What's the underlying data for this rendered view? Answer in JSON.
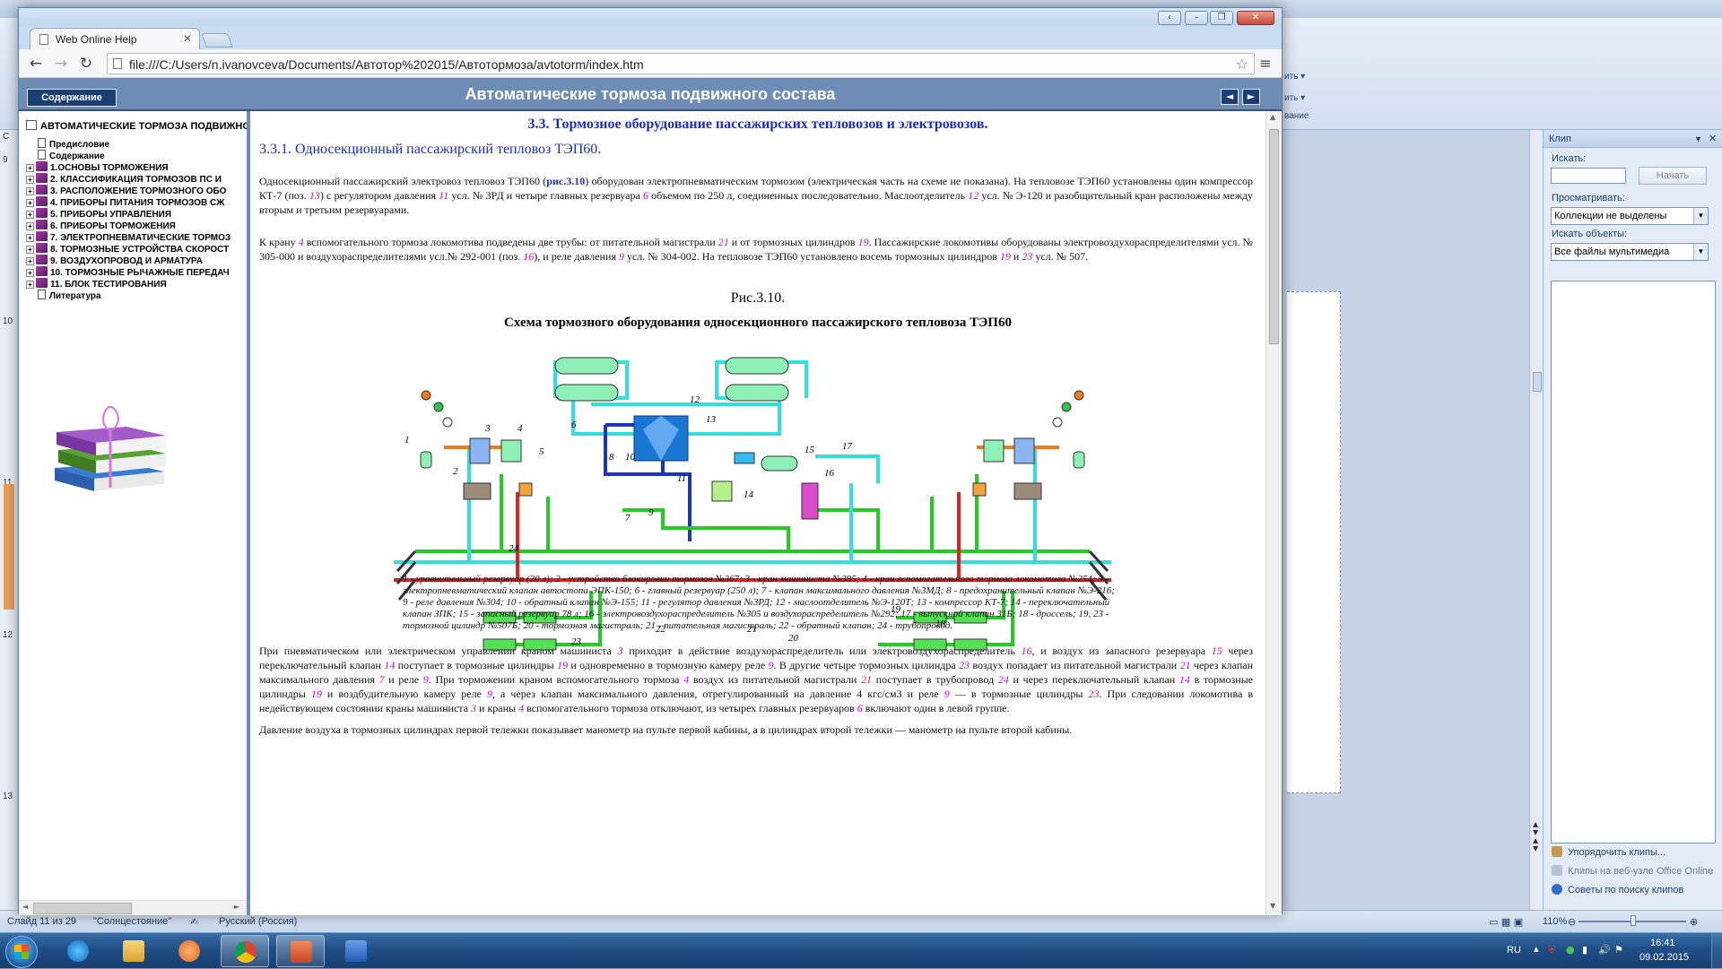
{
  "browser": {
    "tab_title": "Web Online Help",
    "url": "file:///C:/Users/n.ivanovceva/Documents/Автотор%202015/Автотормоза/avtotorm/index.htm",
    "caption_buttons": [
      "‹",
      "–",
      "❐",
      "✕"
    ]
  },
  "help": {
    "toc_tab_label": "Содержание",
    "title": "Автоматические тормоза подвижного состава",
    "nav_prev": "◄",
    "nav_next": "►"
  },
  "toc": {
    "root": "АВТОМАТИЧЕСКИЕ ТОРМОЗА ПОДВИЖНОГ",
    "items": [
      {
        "label": "Предисловие",
        "type": "page"
      },
      {
        "label": "Содержание",
        "type": "page"
      },
      {
        "label": "1.ОСНОВЫ ТОРМОЖЕНИЯ",
        "type": "book"
      },
      {
        "label": "2. КЛАССИФИКАЦИЯ ТОРМОЗОВ ПС И",
        "type": "book"
      },
      {
        "label": "3. РАСПОЛОЖЕНИЕ ТОРМОЗНОГО ОБО",
        "type": "book"
      },
      {
        "label": "4. ПРИБОРЫ ПИТАНИЯ ТОРМОЗОВ СЖ",
        "type": "book"
      },
      {
        "label": "5. ПРИБОРЫ УПРАВЛЕНИЯ",
        "type": "book"
      },
      {
        "label": "6. ПРИБОРЫ ТОРМОЖЕНИЯ",
        "type": "book"
      },
      {
        "label": "7. ЭЛЕКТРОПНЕВМАТИЧЕСКИЕ ТОРМОЗ",
        "type": "book"
      },
      {
        "label": "8. ТОРМОЗНЫЕ УСТРОЙСТВА СКОРОСТ",
        "type": "book"
      },
      {
        "label": "9. ВОЗДУХОПРОВОД И АРМАТУРА",
        "type": "book"
      },
      {
        "label": "10. ТОРМОЗНЫЕ РЫЧАЖНЫЕ ПЕРЕДАЧ",
        "type": "book"
      },
      {
        "label": "11. БЛОК ТЕСТИРОВАНИЯ",
        "type": "book"
      },
      {
        "label": "Литература",
        "type": "page"
      }
    ]
  },
  "content": {
    "section_heading": "3.3. Тормозное оборудование пассажирских тепловозов и электровозов.",
    "subsection_heading": "3.3.1. Односекционный пассажирский тепловоз ТЭП60.",
    "para1": [
      {
        "t": "Односекционный пассажирский электровоз тепловоз ТЭП60 ("
      },
      {
        "t": "рис.3.10",
        "c": "lnk"
      },
      {
        "t": ") оборудован электропневматическим тормозом (электрическая часть на схеме не показана). На тепловозе ТЭП60 установлены один компрессор КТ-7 (поз. "
      },
      {
        "t": "13",
        "c": "n"
      },
      {
        "t": ") с регулятором давления "
      },
      {
        "t": "11",
        "c": "n"
      },
      {
        "t": " усл. № ЗРД и четыре главных резервуара "
      },
      {
        "t": "6",
        "c": "n"
      },
      {
        "t": " объемом по 250 л, соединенных последовательно. Маслоотделитель "
      },
      {
        "t": "12",
        "c": "n"
      },
      {
        "t": " усл. № Э-120 и разобщительный кран расположены между вторым и третьим резервуарами."
      }
    ],
    "para2": [
      {
        "t": "К крану "
      },
      {
        "t": "4",
        "c": "n"
      },
      {
        "t": " вспомогательного тормоза локомотива подведены две трубы: от питательной магистрали "
      },
      {
        "t": "21",
        "c": "n"
      },
      {
        "t": " и от тормозных цилиндров "
      },
      {
        "t": "19",
        "c": "n"
      },
      {
        "t": ". Пассажирские локомотивы оборудованы электровоздухораспределителями усл. № 305-000 и воздухораспределителями усл.№ 292-001 (поз. "
      },
      {
        "t": "16",
        "c": "n"
      },
      {
        "t": "), и реле давления "
      },
      {
        "t": "9",
        "c": "n"
      },
      {
        "t": " усл. № 304-002. На тепловозе ТЭП60 установлено восемь тормозных цилиндров "
      },
      {
        "t": "19",
        "c": "n"
      },
      {
        "t": " и "
      },
      {
        "t": "23",
        "c": "n"
      },
      {
        "t": " усл. № 507."
      }
    ],
    "figure_number": "Рис.3.10.",
    "figure_title": "Схема тормозного оборудования односекционного пассажирского тепловоза ТЭП60",
    "diagram_labels": [
      "1",
      "2",
      "3",
      "4",
      "5",
      "6",
      "7",
      "8",
      "9",
      "10",
      "11",
      "12",
      "13",
      "14",
      "15",
      "16",
      "17",
      "18",
      "19",
      "20",
      "21",
      "22",
      "23",
      "24"
    ],
    "legend": "1 - уравнительный резервуар (20 л); 2 - устройство блокировки тормозов №367; 3 - кран машиниста №395; 4 - кран вспомогательного тормоза локомотива №254; 5 - электропневматический клапан автостопа ЭПК-150; 6 - главный резервуар (250 л); 7 - клапан максимального давления №3МД; 8 - предохранительный клапан №Э-216; 9 - реле давления №304; 10 - обратный клапан №Э-155; 11 - регулятор давления №3РД; 12 - маслоотделитель №Э-120Т; 13 - компрессор КТ-7; 14 - переключательный клапан ЗПК; 15 - запасный резервуар 78 л; 16 - электровоздухораспределитель №305 и воздухораспределитель №292; 17 - выпускной клапан 31Б; 18 - дроссель; 19, 23 - тормозной цилиндр №507Б; 20 - тормозная магистраль; 21 - питательная магистраль; 22 - обратный клапан; 24 - трубопровод.",
    "para3": [
      {
        "t": "При пневматическом или электрическом управлении краном машиниста "
      },
      {
        "t": "3",
        "c": "n"
      },
      {
        "t": " приходит в действие воздухораспределитель или электровоздухораспределитель "
      },
      {
        "t": "16",
        "c": "n"
      },
      {
        "t": ", и воздух из запасного резервуара "
      },
      {
        "t": "15",
        "c": "n"
      },
      {
        "t": " через переключательный клапан "
      },
      {
        "t": "14",
        "c": "n"
      },
      {
        "t": " поступает в тормозные цилиндры "
      },
      {
        "t": "19",
        "c": "n"
      },
      {
        "t": " и одновременно в тормозную камеру реле "
      },
      {
        "t": "9",
        "c": "n"
      },
      {
        "t": ". В другие четыре тормозных цилиндра "
      },
      {
        "t": "23",
        "c": "n"
      },
      {
        "t": " воздух попадает из питательной магистрали "
      },
      {
        "t": "21",
        "c": "n"
      },
      {
        "t": " через клапан максимального давления "
      },
      {
        "t": "7",
        "c": "n"
      },
      {
        "t": " и реле "
      },
      {
        "t": "9",
        "c": "n"
      },
      {
        "t": ". При торможении краном вспомогательного тормоза "
      },
      {
        "t": "4",
        "c": "n"
      },
      {
        "t": " воздух из питательной магистрали "
      },
      {
        "t": "21",
        "c": "n"
      },
      {
        "t": " поступает в трубопровод "
      },
      {
        "t": "24",
        "c": "n"
      },
      {
        "t": " и через переключательный клапан "
      },
      {
        "t": "14",
        "c": "n"
      },
      {
        "t": " в тормозные цилиндры "
      },
      {
        "t": "19",
        "c": "n"
      },
      {
        "t": " и воздбудительную камеру реле "
      },
      {
        "t": "9",
        "c": "n"
      },
      {
        "t": ", а через клапан максимального давления, отрегулированный на давление 4 кгс/см3 и реле "
      },
      {
        "t": "9",
        "c": "n"
      },
      {
        "t": " — в тормозные цилиндры "
      },
      {
        "t": "23",
        "c": "n"
      },
      {
        "t": ". При следовании локомотива в недействующем состоянии краны машиниста "
      },
      {
        "t": "3",
        "c": "n"
      },
      {
        "t": " и краны "
      },
      {
        "t": "4",
        "c": "n"
      },
      {
        "t": " вспомогательного тормоза отключают, из четырех главных резервуаров "
      },
      {
        "t": "6",
        "c": "n"
      },
      {
        "t": " включают один в левой группе."
      }
    ],
    "para4": "Давление воздуха в тормозных цилиндрах первой тележки показывает манометр на пульте первой кабины, а в цилиндрах второй тележки — манометр на пульте второй кабины."
  },
  "background_app": {
    "ribbon_fragments": [
      "ить ▾",
      "ить ▾",
      "вание"
    ],
    "ruler_numbers": [
      "9",
      "10",
      "11",
      "12",
      "13"
    ],
    "left_marker": "С"
  },
  "clip_pane": {
    "title": "Клип",
    "search_label": "Искать:",
    "search_value": "",
    "go_button": "Начать",
    "browse_label": "Просматривать:",
    "browse_value": "Коллекции не выделены",
    "find_label": "Искать объекты:",
    "find_value": "Все файлы мультимедиа",
    "links": [
      "Упорядочить клипы...",
      "Клипы на веб-узле Office Online",
      "Советы по поиску клипов"
    ]
  },
  "statusbar": {
    "slide": "Слайд 11 из 29",
    "theme": "\"Солнцестояние\"",
    "language": "Русский (Россия)",
    "zoom": "110%"
  },
  "taskbar": {
    "lang": "RU",
    "time": "16:41",
    "date": "09.02.2015"
  }
}
